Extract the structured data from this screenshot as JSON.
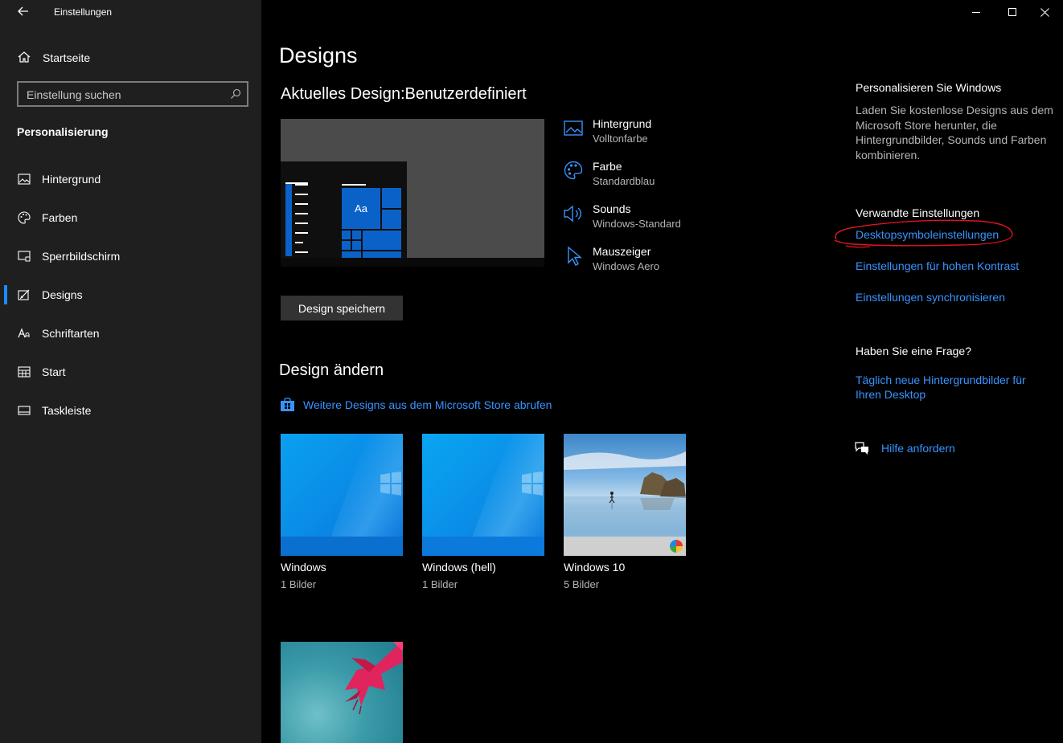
{
  "window": {
    "title": "Einstellungen",
    "back_icon": "arrow-left-icon",
    "minimize_icon": "minimize-icon",
    "maximize_icon": "maximize-icon",
    "close_icon": "close-icon"
  },
  "sidebar": {
    "home_label": "Startseite",
    "search_placeholder": "Einstellung suchen",
    "section_title": "Personalisierung",
    "items": [
      {
        "label": "Hintergrund",
        "icon": "image-icon"
      },
      {
        "label": "Farben",
        "icon": "palette-icon"
      },
      {
        "label": "Sperrbildschirm",
        "icon": "lock-screen-icon"
      },
      {
        "label": "Designs",
        "icon": "brush-icon",
        "active": true
      },
      {
        "label": "Schriftarten",
        "icon": "font-icon"
      },
      {
        "label": "Start",
        "icon": "start-icon"
      },
      {
        "label": "Taskleiste",
        "icon": "taskbar-icon"
      }
    ]
  },
  "main": {
    "page_title": "Designs",
    "current_design_label": "Aktuelles Design:",
    "current_design_value": "Benutzerdefiniert",
    "preview_tile_text": "Aa",
    "save_button": "Design speichern",
    "properties": [
      {
        "title": "Hintergrund",
        "value": "Volltonfarbe",
        "icon": "picture-icon"
      },
      {
        "title": "Farbe",
        "value": "Standardblau",
        "icon": "palette-icon"
      },
      {
        "title": "Sounds",
        "value": "Windows-Standard",
        "icon": "speaker-icon"
      },
      {
        "title": "Mauszeiger",
        "value": "Windows Aero",
        "icon": "cursor-icon"
      }
    ],
    "change_design_title": "Design ändern",
    "store_link": "Weitere Designs aus dem Microsoft Store abrufen",
    "themes": [
      {
        "name": "Windows",
        "count": "1 Bilder"
      },
      {
        "name": "Windows (hell)",
        "count": "1 Bilder"
      },
      {
        "name": "Windows 10",
        "count": "5 Bilder"
      }
    ]
  },
  "right": {
    "personalize_title": "Personalisieren Sie Windows",
    "personalize_text": "Laden Sie kostenlose Designs aus dem Microsoft Store herunter, die Hintergrundbilder, Sounds und Farben kombinieren.",
    "related_title": "Verwandte Einstellungen",
    "links": [
      "Desktopsymboleinstellungen",
      "Einstellungen für hohen Kontrast",
      "Einstellungen synchronisieren"
    ],
    "question_title": "Haben Sie eine Frage?",
    "question_link": "Täglich neue Hintergrundbilder für Ihren Desktop",
    "help_link": "Hilfe anfordern",
    "annotation_color": "#e0141e"
  },
  "colors": {
    "accent": "#0078d7",
    "link": "#3794ff",
    "sidebar_bg": "#1f1f1f"
  }
}
